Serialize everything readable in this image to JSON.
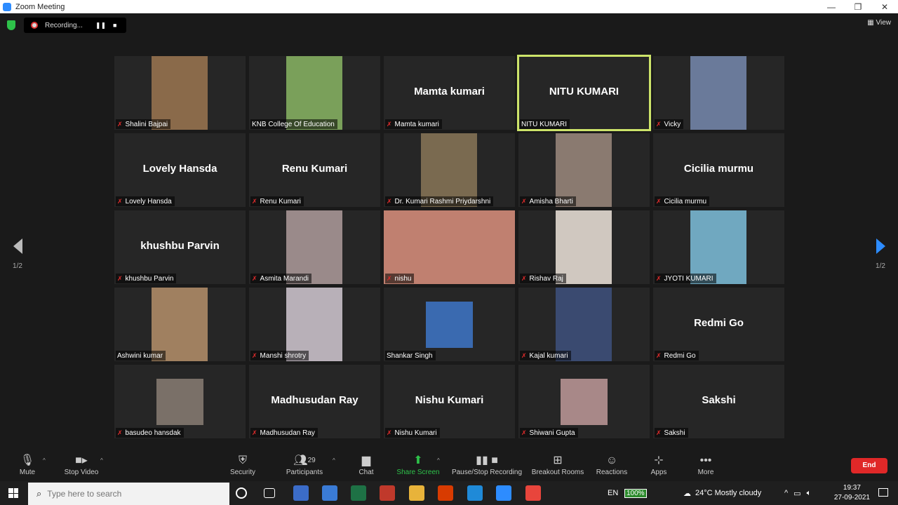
{
  "window": {
    "title": "Zoom Meeting",
    "controls": [
      "—",
      "❐",
      "✕"
    ]
  },
  "recording": {
    "label": "Recording...",
    "pause": "❚❚",
    "stop": "■"
  },
  "view_label": "View",
  "pager": {
    "left": "1/2",
    "right": "1/2"
  },
  "tiles": [
    {
      "name": "Shalini Bajpai",
      "mode": "video",
      "color": "#8a6a4a",
      "muted": true
    },
    {
      "name": "KNB College Of Education",
      "mode": "video",
      "color": "#7aa05a",
      "muted": false
    },
    {
      "name": "Mamta kumari",
      "mode": "name",
      "muted": true
    },
    {
      "name": "NITU KUMARI",
      "mode": "name",
      "muted": false,
      "active": true
    },
    {
      "name": "Vicky",
      "mode": "video",
      "color": "#6a7a9a",
      "muted": true
    },
    {
      "name": "Lovely Hansda",
      "mode": "name",
      "muted": true
    },
    {
      "name": "Renu Kumari",
      "mode": "name",
      "muted": true
    },
    {
      "name": "Dr. Kumari Rashmi Priydarshni",
      "mode": "video",
      "color": "#7a6a50",
      "muted": true
    },
    {
      "name": "Amisha Bharti",
      "mode": "video",
      "color": "#8a7a70",
      "muted": true
    },
    {
      "name": "Cicilia murmu",
      "mode": "name",
      "muted": true
    },
    {
      "name": "khushbu Parvin",
      "mode": "name",
      "muted": true
    },
    {
      "name": "Asmita Marandi",
      "mode": "video",
      "color": "#9a8a8a",
      "muted": true
    },
    {
      "name": "nishu",
      "mode": "video",
      "color": "#c08070",
      "muted": true,
      "wide": true
    },
    {
      "name": "Rishav Raj",
      "mode": "video",
      "color": "#d0c8c0",
      "muted": true
    },
    {
      "name": "JYOTI KUMARI",
      "mode": "video",
      "color": "#70a8c0",
      "muted": true
    },
    {
      "name": "Ashwini kumar",
      "mode": "video",
      "color": "#a08060",
      "muted": false
    },
    {
      "name": "Manshi shrotry",
      "mode": "video",
      "color": "#b8b0b8",
      "muted": true
    },
    {
      "name": "Shankar Singh",
      "mode": "photo",
      "color": "#3a6ab0",
      "muted": false
    },
    {
      "name": "Kajal kumari",
      "mode": "video",
      "color": "#3a4a70",
      "muted": true
    },
    {
      "name": "Redmi Go",
      "mode": "name",
      "muted": true
    },
    {
      "name": "basudeo hansdak",
      "mode": "photo",
      "color": "#7a7068",
      "muted": true
    },
    {
      "name": "Madhusudan Ray",
      "mode": "name",
      "muted": true
    },
    {
      "name": "Nishu Kumari",
      "mode": "name",
      "muted": true
    },
    {
      "name": "Shiwani Gupta",
      "mode": "photo",
      "color": "#a88888",
      "muted": true
    },
    {
      "name": "Sakshi",
      "mode": "name",
      "muted": true
    }
  ],
  "toolbar": {
    "mute": "Mute",
    "stop_video": "Stop Video",
    "security": "Security",
    "participants": "Participants",
    "participants_count": "29",
    "chat": "Chat",
    "share_screen": "Share Screen",
    "pause_stop_recording": "Pause/Stop Recording",
    "breakout_rooms": "Breakout Rooms",
    "reactions": "Reactions",
    "apps": "Apps",
    "more": "More",
    "end": "End"
  },
  "taskbar": {
    "search_placeholder": "Type here to search",
    "lang": "EN",
    "battery": "100%",
    "weather": "24°C  Mostly cloudy",
    "time": "19:37",
    "date": "27-09-2021",
    "apps": [
      {
        "name": "cortana-icon",
        "color": "#1f1f1f"
      },
      {
        "name": "task-view-icon",
        "color": "#1f1f1f"
      },
      {
        "name": "app-icon-1",
        "color": "#3b6cc8"
      },
      {
        "name": "store-icon",
        "color": "#3a7bd5"
      },
      {
        "name": "excel-icon",
        "color": "#1e7145"
      },
      {
        "name": "app-icon-2",
        "color": "#c0392b"
      },
      {
        "name": "file-explorer-icon",
        "color": "#e8b33a"
      },
      {
        "name": "office-icon",
        "color": "#d83b01"
      },
      {
        "name": "edge-icon",
        "color": "#1f8ad8"
      },
      {
        "name": "zoom-icon",
        "color": "#2d8cff"
      },
      {
        "name": "chrome-icon",
        "color": "#e8453c"
      }
    ]
  }
}
